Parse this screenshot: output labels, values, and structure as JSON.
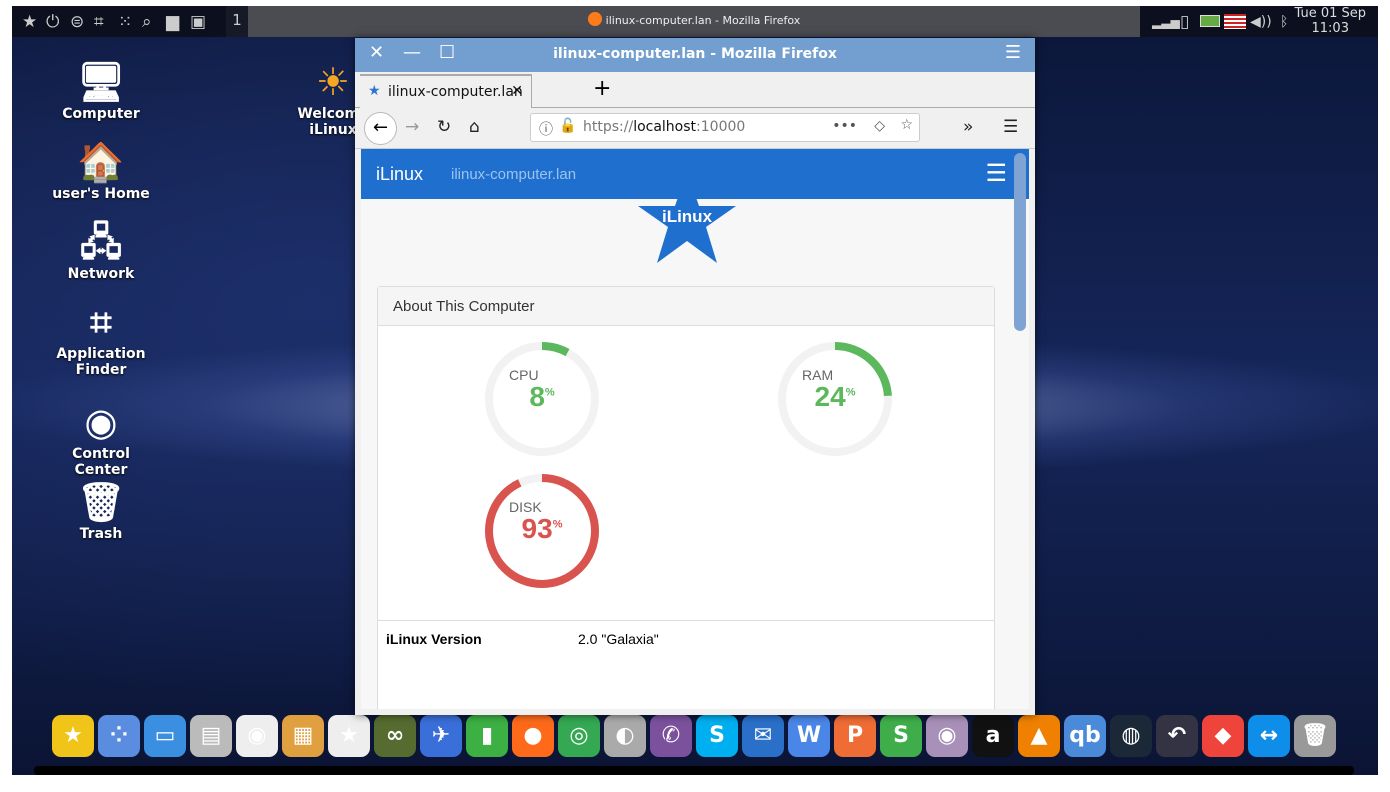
{
  "panel": {
    "workspace": "1",
    "task": "ilinux-computer.lan - Mozilla Firefox",
    "clock_day": "Tue 01 Sep",
    "clock_time": "11:03",
    "left_icons": [
      "star-icon",
      "power-icon",
      "toggle-icon",
      "binoculars-icon",
      "apps-icon",
      "search-icon",
      "folder-icon",
      "desktop-icon"
    ],
    "tray_icons": [
      "signal-icon",
      "clipboard-icon",
      "battery-icon",
      "us-flag-icon",
      "volume-icon",
      "bluetooth-icon"
    ]
  },
  "desktop": {
    "icons": [
      {
        "label": "Computer",
        "icon": "computer-icon"
      },
      {
        "label": "user's Home",
        "icon": "home-icon"
      },
      {
        "label": "Network",
        "icon": "network-icon"
      },
      {
        "label": "Application Finder",
        "icon": "binoculars-icon"
      },
      {
        "label": "Control Center",
        "icon": "control-center-icon"
      },
      {
        "label": "Trash",
        "icon": "trash-icon"
      },
      {
        "label": "Welcome iLinux",
        "icon": "sun-icon"
      }
    ]
  },
  "window": {
    "title": "ilinux-computer.lan - Mozilla Firefox",
    "tab_label": "ilinux-computer.lan",
    "url_scheme": "https://",
    "url_host": "localhost",
    "url_port": ":10000"
  },
  "site": {
    "brand": "iLinux",
    "host": "ilinux-computer.lan",
    "logo_text": "iLinux",
    "brand_color": "#1f6fcf",
    "card_title": "About This Computer",
    "gauges": [
      {
        "label": "CPU",
        "value": 8,
        "unit": "%",
        "color": "#5cb85c"
      },
      {
        "label": "RAM",
        "value": 24,
        "unit": "%",
        "color": "#5cb85c"
      },
      {
        "label": "DISK",
        "value": 93,
        "unit": "%",
        "color": "#d9534f"
      }
    ],
    "info": [
      {
        "key": "iLinux Version",
        "value": "2.0 \"Galaxia\""
      }
    ]
  },
  "dock": [
    {
      "name": "welcome",
      "color": "#f0c419",
      "g": "★"
    },
    {
      "name": "apps",
      "color": "#5a8de0",
      "g": "⁘"
    },
    {
      "name": "desktop",
      "color": "#3b8fe0",
      "g": "▭"
    },
    {
      "name": "file-cabinet",
      "color": "#bbb",
      "g": "▤"
    },
    {
      "name": "control-center",
      "color": "#eee",
      "g": "◉"
    },
    {
      "name": "color-palette",
      "color": "#e0a040",
      "g": "▦"
    },
    {
      "name": "store",
      "color": "#eee",
      "g": "★"
    },
    {
      "name": "binoculars",
      "color": "#556b2f",
      "g": "∞"
    },
    {
      "name": "rocket",
      "color": "#3a6ed8",
      "g": "✈"
    },
    {
      "name": "pipe",
      "color": "#3cb043",
      "g": "▮"
    },
    {
      "name": "firefox",
      "color": "#ff6a1a",
      "g": "●"
    },
    {
      "name": "chrome",
      "color": "#34a853",
      "g": "◎"
    },
    {
      "name": "google-earth-pro",
      "color": "#aaa",
      "g": "◐"
    },
    {
      "name": "viber",
      "color": "#7b519d",
      "g": "✆"
    },
    {
      "name": "skype",
      "color": "#00aff0",
      "g": "S"
    },
    {
      "name": "thunderbird",
      "color": "#2a6fc8",
      "g": "✉"
    },
    {
      "name": "wps-writer",
      "color": "#4a86e8",
      "g": "W"
    },
    {
      "name": "wps-presentation",
      "color": "#ef6c35",
      "g": "P"
    },
    {
      "name": "wps-spreadsheet",
      "color": "#3fae4a",
      "g": "S"
    },
    {
      "name": "webcam",
      "color": "#a890b8",
      "g": "◉"
    },
    {
      "name": "anydesk-a",
      "color": "#111",
      "g": "a"
    },
    {
      "name": "vlc",
      "color": "#f08000",
      "g": "▲"
    },
    {
      "name": "qbittorrent",
      "color": "#4a8ad8",
      "g": "qb"
    },
    {
      "name": "steam",
      "color": "#1b2838",
      "g": "◍"
    },
    {
      "name": "restore",
      "color": "#334",
      "g": "↶"
    },
    {
      "name": "anydesk",
      "color": "#ef443b",
      "g": "◆"
    },
    {
      "name": "teamviewer",
      "color": "#0e8ee9",
      "g": "↔"
    },
    {
      "name": "trash",
      "color": "#999",
      "g": "🗑"
    }
  ]
}
